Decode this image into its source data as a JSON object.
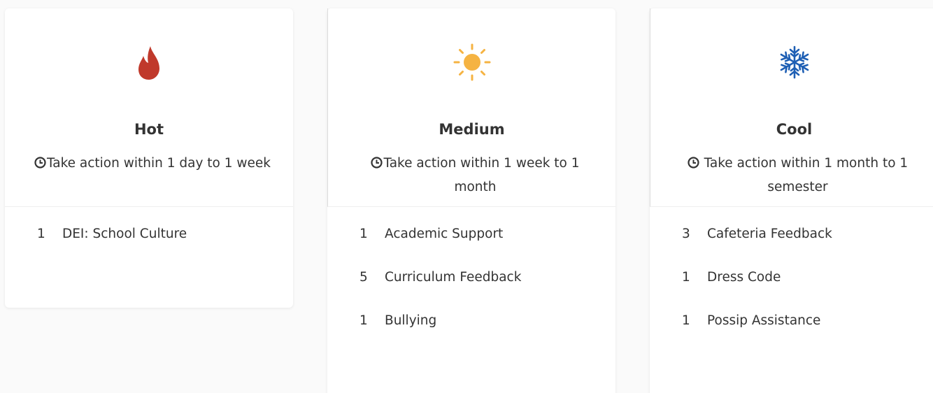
{
  "cards": [
    {
      "title": "Hot",
      "icon": "fire-icon",
      "icon_color": "#c0392b",
      "description": "Take action within 1 day to 1 week",
      "items": [
        {
          "count": "1",
          "label": "DEI: School Culture"
        }
      ]
    },
    {
      "title": "Medium",
      "icon": "sun-icon",
      "icon_color": "#f5b342",
      "description": "Take action within 1 week to 1 month",
      "items": [
        {
          "count": "1",
          "label": "Academic Support"
        },
        {
          "count": "5",
          "label": "Curriculum Feedback"
        },
        {
          "count": "1",
          "label": "Bullying"
        }
      ]
    },
    {
      "title": "Cool",
      "icon": "snowflake-icon",
      "icon_color": "#1e5fb4",
      "description": " Take action within 1 month to 1 semester",
      "items": [
        {
          "count": "3",
          "label": "Cafeteria Feedback"
        },
        {
          "count": "1",
          "label": "Dress Code"
        },
        {
          "count": "1",
          "label": "Possip Assistance"
        }
      ]
    }
  ]
}
